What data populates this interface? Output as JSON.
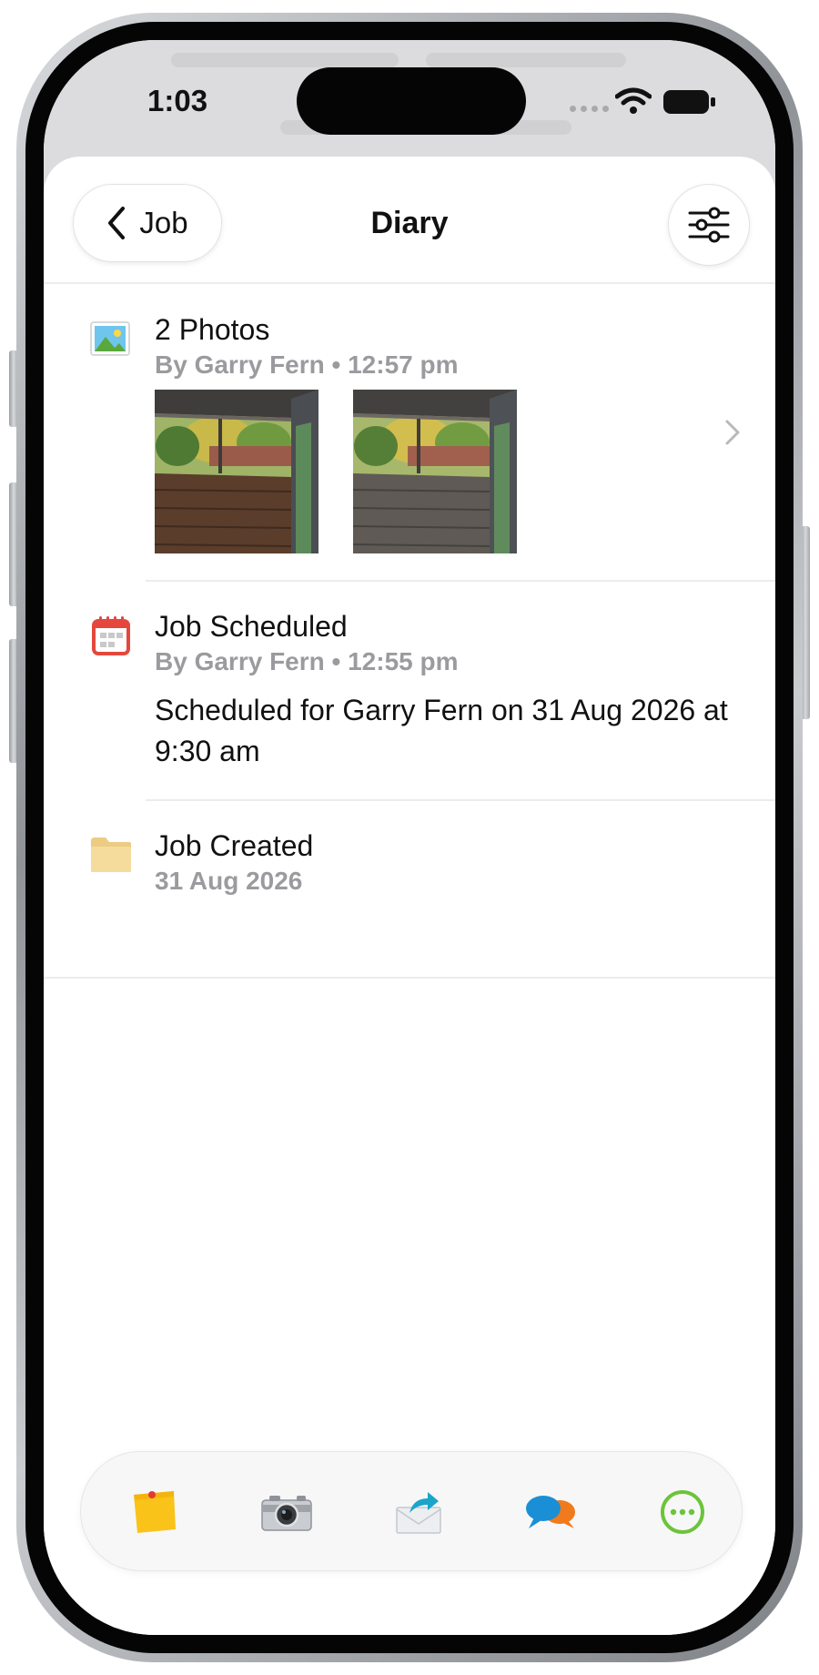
{
  "status_bar": {
    "time": "1:03"
  },
  "nav": {
    "back_label": "Job",
    "title": "Diary"
  },
  "diary": [
    {
      "title": "2 Photos",
      "subtitle": "By Garry Fern • 12:57 pm",
      "icon": "photo-icon",
      "photos": 2
    },
    {
      "title": "Job Scheduled",
      "subtitle": "By Garry Fern • 12:55 pm",
      "icon": "calendar-icon",
      "body": "Scheduled for Garry Fern on 31 Aug 2026 at 9:30 am"
    },
    {
      "title": "Job Created",
      "subtitle": "31 Aug 2026",
      "icon": "folder-icon"
    }
  ],
  "toolbar": {
    "items": [
      "sticky-note-icon",
      "camera-icon",
      "forward-mail-icon",
      "chat-bubbles-icon",
      "more-icon"
    ]
  },
  "colors": {
    "calendar_red": "#e5473d",
    "more_green": "#6cc43a",
    "chat_blue": "#1b8fd6",
    "chat_orange": "#f07a1c",
    "folder_tan": "#f6dc9c",
    "note_yellow": "#f9c31a"
  }
}
